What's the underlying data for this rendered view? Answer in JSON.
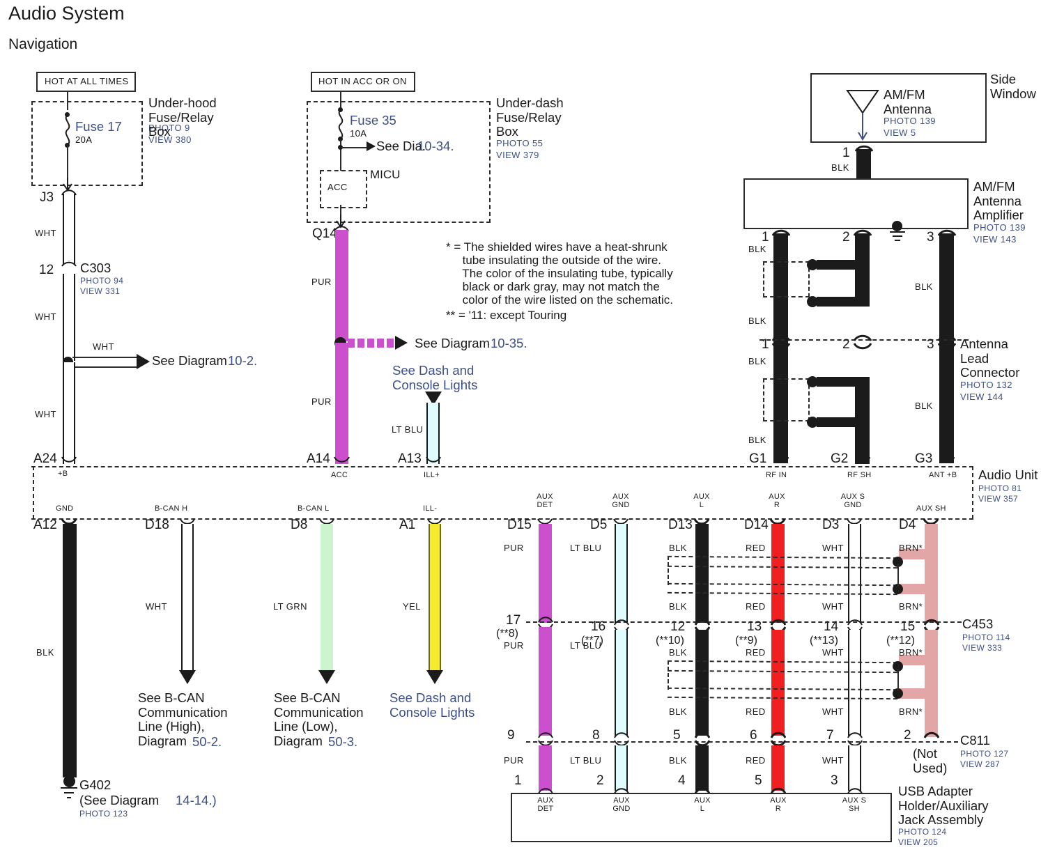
{
  "title": "Audio System",
  "subtitle": "Navigation",
  "power_sources": {
    "hot_all_times": "HOT AT ALL TIMES",
    "hot_acc_on": "HOT IN ACC OR ON"
  },
  "underhood_box": {
    "name": "Under-hood\nFuse/Relay\nBox",
    "photo": "PHOTO 9",
    "view": "VIEW 380",
    "fuse_label": "Fuse 17",
    "fuse_rating": "20A",
    "out_pin": "J3"
  },
  "underdash_box": {
    "name": "Under-dash\nFuse/Relay\nBox",
    "photo": "PHOTO 55",
    "view": "VIEW 379",
    "fuse_label": "Fuse 35",
    "fuse_rating": "10A",
    "see_dia_prefix": "See Dia.",
    "see_dia_num": "10-34.",
    "micu_label": "MICU",
    "acc_label": "ACC",
    "out_pin": "Q14"
  },
  "notes": {
    "star": "* = The shielded wires have a heat-shrunk\n     tube insulating the outside of the wire.\n     The color of the insulating tube, typically\n     black or dark gray, may not match the\n     color of the wire listed on the schematic.",
    "doublestar": "** = '11: except Touring"
  },
  "connector_c303": {
    "pin": "12",
    "name": "C303",
    "photo": "PHOTO 94",
    "view": "VIEW 331"
  },
  "branches": {
    "see_diagram_10_2_prefix": "See Diagram ",
    "see_diagram_10_2_num": "10-2.",
    "see_diagram_10_35_prefix": "See Diagram ",
    "see_diagram_10_35_num": "10-35.",
    "dash_console_top": "See Dash and\nConsole Lights",
    "bcan_high": "See B-CAN\nCommunication\nLine (High),\nDiagram ",
    "bcan_high_num": "50-2.",
    "bcan_low": "See B-CAN\nCommunication\nLine (Low),\nDiagram ",
    "bcan_low_num": "50-3.",
    "dash_console_bottom": "See Dash and\nConsole Lights"
  },
  "side_window": {
    "label": "Side\nWindow",
    "antenna_name": "AM/FM\nAntenna",
    "photo": "PHOTO 139",
    "view": "VIEW 5",
    "out_pin": "1",
    "out_color": "BLK"
  },
  "antenna_amp": {
    "name": "AM/FM\nAntenna\nAmplifier",
    "photo": "PHOTO 139",
    "view": "VIEW 143",
    "pins": [
      "1",
      "2",
      "3"
    ],
    "colors_top": [
      "BLK",
      "",
      "BLK"
    ]
  },
  "antenna_lead_connector": {
    "name": "Antenna\nLead\nConnector",
    "photo": "PHOTO 132",
    "view": "VIEW 144",
    "pins": [
      "1",
      "2",
      "3"
    ],
    "colors_above": [
      "BLK",
      "",
      ""
    ],
    "colors_below": [
      "BLK",
      "",
      "BLK"
    ],
    "colors_bottom": [
      "BLK",
      "",
      ""
    ]
  },
  "audio_unit": {
    "name": "Audio Unit",
    "photo": "PHOTO 81",
    "view": "VIEW 357",
    "top_terminals": [
      {
        "pin": "A24",
        "signal": "+B",
        "color": "WHT",
        "wire": "wht"
      },
      {
        "pin": "A14",
        "signal": "ACC",
        "color": "PUR",
        "wire": "pur"
      },
      {
        "pin": "A13",
        "signal": "ILL+",
        "color": "LT BLU",
        "wire": "ltblu"
      },
      {
        "pin": "G1",
        "signal": "RF IN",
        "color": "BLK",
        "wire": "blk"
      },
      {
        "pin": "G2",
        "signal": "RF SH",
        "color": "BLK",
        "wire": "blk"
      },
      {
        "pin": "G3",
        "signal": "ANT +B",
        "color": "BLK",
        "wire": "blk"
      }
    ],
    "bottom_terminals": [
      {
        "pin": "A12",
        "signal": "GND",
        "color": "BLK",
        "wire": "blk"
      },
      {
        "pin": "D18",
        "signal": "B-CAN H",
        "color": "WHT",
        "wire": "wht"
      },
      {
        "pin": "D8",
        "signal": "B-CAN L",
        "color": "LT GRN",
        "wire": "ltgrn"
      },
      {
        "pin": "A1",
        "signal": "ILL-",
        "color": "YEL",
        "wire": "yel"
      },
      {
        "pin": "D15",
        "signal": "AUX\nDET",
        "color": "PUR",
        "wire": "pur"
      },
      {
        "pin": "D5",
        "signal": "AUX\nGND",
        "color": "LT BLU",
        "wire": "ltblu"
      },
      {
        "pin": "D13",
        "signal": "AUX\nL",
        "color": "BLK",
        "wire": "blk"
      },
      {
        "pin": "D14",
        "signal": "AUX\nR",
        "color": "RED",
        "wire": "red"
      },
      {
        "pin": "D3",
        "signal": "AUX S\nGND",
        "color": "WHT",
        "wire": "wht"
      },
      {
        "pin": "D4",
        "signal": "AUX SH",
        "color": "BRN*",
        "wire": "brn"
      }
    ]
  },
  "connector_c453": {
    "name": "C453",
    "photo": "PHOTO 114",
    "view": "VIEW 333",
    "pins": [
      "17",
      "16",
      "12",
      "13",
      "14",
      "15"
    ],
    "alt_pins": [
      "(**8)",
      "(**7)",
      "(**10)",
      "(**9)",
      "(**13)",
      "(**12)"
    ],
    "colors_above": [
      "PUR",
      "LT BLU",
      "BLK",
      "RED",
      "WHT",
      "BRN*"
    ],
    "colors_below": [
      "PUR",
      "LT BLU",
      "BLK",
      "RED",
      "WHT",
      "BRN*"
    ]
  },
  "connector_c811": {
    "name": "C811",
    "photo": "PHOTO 127",
    "view": "VIEW 287",
    "pins": [
      "9",
      "8",
      "5",
      "6",
      "7",
      "2"
    ],
    "not_used": "(Not\nUsed)",
    "colors_above": [
      "PUR",
      "LT BLU",
      "BLK",
      "RED",
      "WHT",
      "BRN*"
    ],
    "colors_below": [
      "PUR",
      "LT BLU",
      "BLK",
      "RED",
      "WHT",
      ""
    ]
  },
  "usb_adapter": {
    "name": "USB Adapter\nHolder/Auxiliary\nJack Assembly",
    "photo": "PHOTO 124",
    "view": "VIEW 205",
    "pins": [
      "1",
      "2",
      "4",
      "5",
      "3"
    ],
    "signals": [
      "AUX\nDET",
      "AUX\nGND",
      "AUX\nL",
      "AUX\nR",
      "AUX S\nSH"
    ]
  },
  "ground_g402": {
    "name": "G402",
    "ref_prefix": "(See Diagram ",
    "ref_num": "14-14.)",
    "photo": "PHOTO 123"
  },
  "colors": {
    "accent_blue": "#3d4f86",
    "wire_purple": "#cc4fce",
    "wire_red": "#f02020",
    "wire_ltblue": "#dffbfb",
    "wire_ltgreen": "#cdf5cd",
    "wire_yellow": "#f5ea2e",
    "wire_brown": "#e3a6a6",
    "wire_black": "#1b1b1b"
  }
}
